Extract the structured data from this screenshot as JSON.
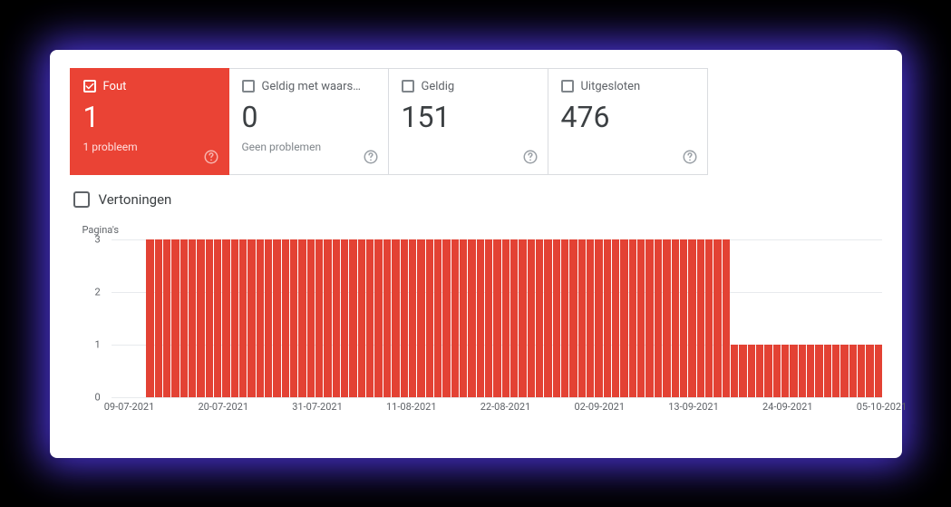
{
  "cards": [
    {
      "label": "Fout",
      "value": "1",
      "sub": "1 probleem",
      "active": true
    },
    {
      "label": "Geldig met waars…",
      "value": "0",
      "sub": "Geen problemen",
      "active": false
    },
    {
      "label": "Geldig",
      "value": "151",
      "sub": "",
      "active": false
    },
    {
      "label": "Uitgesloten",
      "value": "476",
      "sub": "",
      "active": false
    }
  ],
  "impressions": {
    "label": "Vertoningen"
  },
  "chart": {
    "ylabel": "Pagina's"
  },
  "y_ticks": [
    "0",
    "1",
    "2",
    "3"
  ],
  "x_ticks": [
    "09-07-2021",
    "20-07-2021",
    "31-07-2021",
    "11-08-2021",
    "22-08-2021",
    "02-09-2021",
    "13-09-2021",
    "24-09-2021",
    "05-10-2021"
  ],
  "chart_data": {
    "type": "bar",
    "title": "",
    "xlabel": "",
    "ylabel": "Pagina's",
    "ylim": [
      0,
      3
    ],
    "categories": [
      "09-07-2021",
      "10-07-2021",
      "11-07-2021",
      "12-07-2021",
      "13-07-2021",
      "14-07-2021",
      "15-07-2021",
      "16-07-2021",
      "17-07-2021",
      "18-07-2021",
      "19-07-2021",
      "20-07-2021",
      "21-07-2021",
      "22-07-2021",
      "23-07-2021",
      "24-07-2021",
      "25-07-2021",
      "26-07-2021",
      "27-07-2021",
      "28-07-2021",
      "29-07-2021",
      "30-07-2021",
      "31-07-2021",
      "01-08-2021",
      "02-08-2021",
      "03-08-2021",
      "04-08-2021",
      "05-08-2021",
      "06-08-2021",
      "07-08-2021",
      "08-08-2021",
      "09-08-2021",
      "10-08-2021",
      "11-08-2021",
      "12-08-2021",
      "13-08-2021",
      "14-08-2021",
      "15-08-2021",
      "16-08-2021",
      "17-08-2021",
      "18-08-2021",
      "19-08-2021",
      "20-08-2021",
      "21-08-2021",
      "22-08-2021",
      "23-08-2021",
      "24-08-2021",
      "25-08-2021",
      "26-08-2021",
      "27-08-2021",
      "28-08-2021",
      "29-08-2021",
      "30-08-2021",
      "31-08-2021",
      "01-09-2021",
      "02-09-2021",
      "03-09-2021",
      "04-09-2021",
      "05-09-2021",
      "06-09-2021",
      "07-09-2021",
      "08-09-2021",
      "09-09-2021",
      "10-09-2021",
      "11-09-2021",
      "12-09-2021",
      "13-09-2021",
      "14-09-2021",
      "15-09-2021",
      "16-09-2021",
      "17-09-2021",
      "18-09-2021",
      "19-09-2021",
      "20-09-2021",
      "21-09-2021",
      "22-09-2021",
      "23-09-2021",
      "24-09-2021",
      "25-09-2021",
      "26-09-2021",
      "27-09-2021",
      "28-09-2021",
      "29-09-2021",
      "30-09-2021",
      "01-10-2021",
      "02-10-2021",
      "03-10-2021",
      "04-10-2021",
      "05-10-2021"
    ],
    "values": [
      0,
      0,
      3,
      3,
      3,
      3,
      3,
      3,
      3,
      3,
      3,
      3,
      3,
      3,
      3,
      3,
      3,
      3,
      3,
      3,
      3,
      3,
      3,
      3,
      3,
      3,
      3,
      3,
      3,
      3,
      3,
      3,
      3,
      3,
      3,
      3,
      3,
      3,
      3,
      3,
      3,
      3,
      3,
      3,
      3,
      3,
      3,
      3,
      3,
      3,
      3,
      3,
      3,
      3,
      3,
      3,
      3,
      3,
      3,
      3,
      3,
      3,
      3,
      3,
      3,
      3,
      3,
      3,
      3,
      3,
      3,
      1,
      1,
      1,
      1,
      1,
      1,
      1,
      1,
      1,
      1,
      1,
      1,
      1,
      1,
      1,
      1,
      1,
      1
    ],
    "x_axis_tick_labels": [
      "09-07-2021",
      "20-07-2021",
      "31-07-2021",
      "11-08-2021",
      "22-08-2021",
      "02-09-2021",
      "13-09-2021",
      "24-09-2021",
      "05-10-2021"
    ],
    "series_color": "#e34234"
  }
}
